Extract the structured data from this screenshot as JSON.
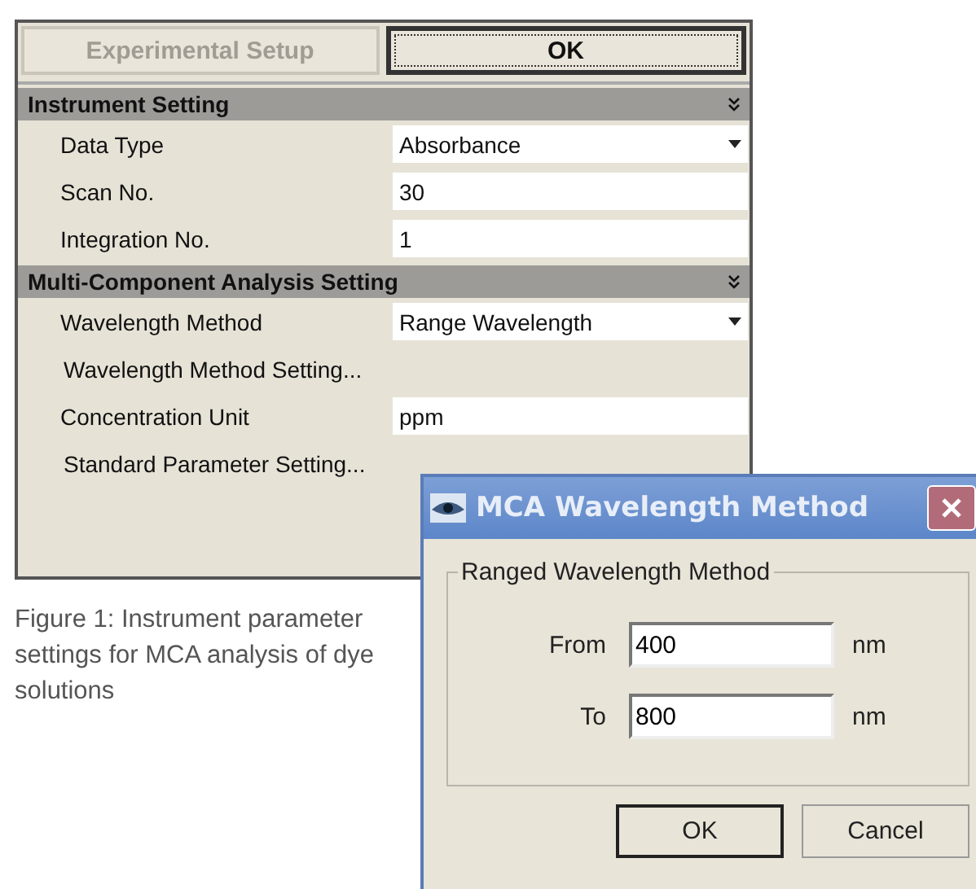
{
  "panel": {
    "buttons": [
      {
        "label": "Experimental Setup",
        "disabled": true,
        "focused": false
      },
      {
        "label": "OK",
        "disabled": false,
        "focused": true
      }
    ],
    "sections": [
      {
        "title": "Instrument Setting",
        "rows": [
          {
            "kind": "dropdown",
            "label": "Data Type",
            "value": "Absorbance"
          },
          {
            "kind": "field",
            "label": "Scan No.",
            "value": "30"
          },
          {
            "kind": "field",
            "label": "Integration No.",
            "value": "1"
          }
        ]
      },
      {
        "title": "Multi-Component Analysis Setting",
        "rows": [
          {
            "kind": "dropdown",
            "label": "Wavelength Method",
            "value": "Range Wavelength"
          },
          {
            "kind": "link",
            "label": "Wavelength Method Setting..."
          },
          {
            "kind": "field",
            "label": "Concentration Unit",
            "value": "ppm"
          },
          {
            "kind": "link",
            "label": "Standard Parameter Setting..."
          }
        ]
      }
    ]
  },
  "caption": "Figure 1: Instrument parameter settings for MCA analysis of dye solutions",
  "dialog": {
    "title": "MCA Wavelength Method",
    "group": "Ranged Wavelength Method",
    "fields": [
      {
        "label": "From",
        "value": "400",
        "unit": "nm"
      },
      {
        "label": "To",
        "value": "800",
        "unit": "nm"
      }
    ],
    "buttons": [
      {
        "label": "OK",
        "default": true
      },
      {
        "label": "Cancel",
        "default": false
      }
    ]
  }
}
